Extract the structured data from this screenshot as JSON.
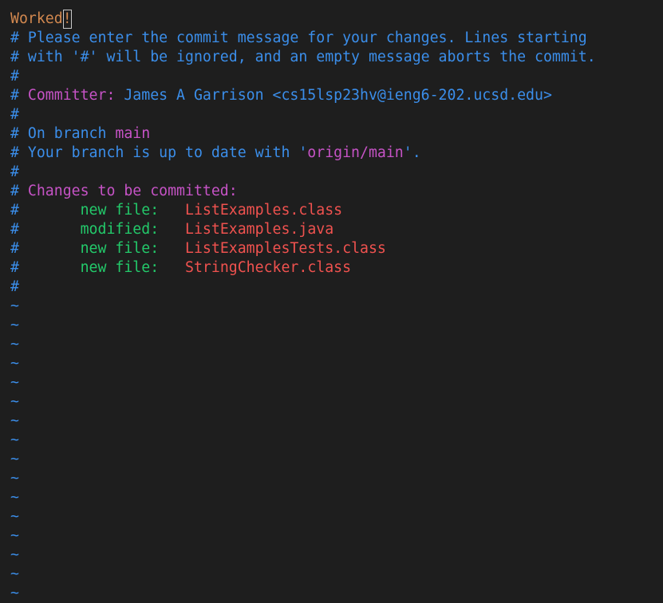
{
  "editor": {
    "message_text": "Worked",
    "cursor_char": "!"
  },
  "comments": {
    "hash": "#",
    "intro_line1": " Please enter the commit message for your changes. Lines starting",
    "intro_line2": " with '#' will be ignored, and an empty message aborts the commit.",
    "committer_label": "Committer:",
    "committer_value": " James A Garrison <cs15lsp23hv@ieng6-202.ucsd.edu>",
    "on_branch_prefix": " On branch ",
    "branch_name": "main",
    "up_to_date_prefix": " Your branch is up to date with '",
    "upstream": "origin/main",
    "up_to_date_suffix": "'.",
    "changes_header": "Changes to be committed:",
    "indent": "       ",
    "changes": [
      {
        "status": "new file:",
        "pad": "   ",
        "file": "ListExamples.class"
      },
      {
        "status": "modified:",
        "pad": "   ",
        "file": "ListExamples.java"
      },
      {
        "status": "new file:",
        "pad": "   ",
        "file": "ListExamplesTests.class"
      },
      {
        "status": "new file:",
        "pad": "   ",
        "file": "StringChecker.class"
      }
    ]
  },
  "tilde": "~",
  "colors": {
    "background": "#1e1e1e",
    "comment_blue": "#3b8eea",
    "message_orange": "#d2884f",
    "keyword_magenta": "#c653c6",
    "status_green": "#23c96a",
    "file_red": "#f0524f"
  }
}
